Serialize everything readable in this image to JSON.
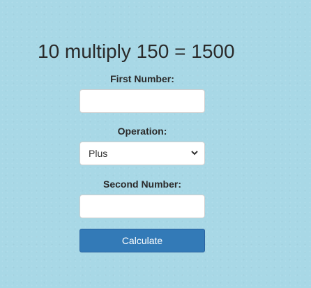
{
  "result_text": "10 multiply 150 = 1500",
  "form": {
    "first_number_label": "First Number:",
    "first_number_value": "",
    "operation_label": "Operation:",
    "operation_selected": "Plus",
    "second_number_label": "Second Number:",
    "second_number_value": "",
    "calculate_label": "Calculate"
  },
  "colors": {
    "background": "#a8d8e6",
    "button": "#337ab7",
    "button_text": "#ffffff"
  },
  "icons": {
    "select_arrow": "chevron-down-icon"
  }
}
